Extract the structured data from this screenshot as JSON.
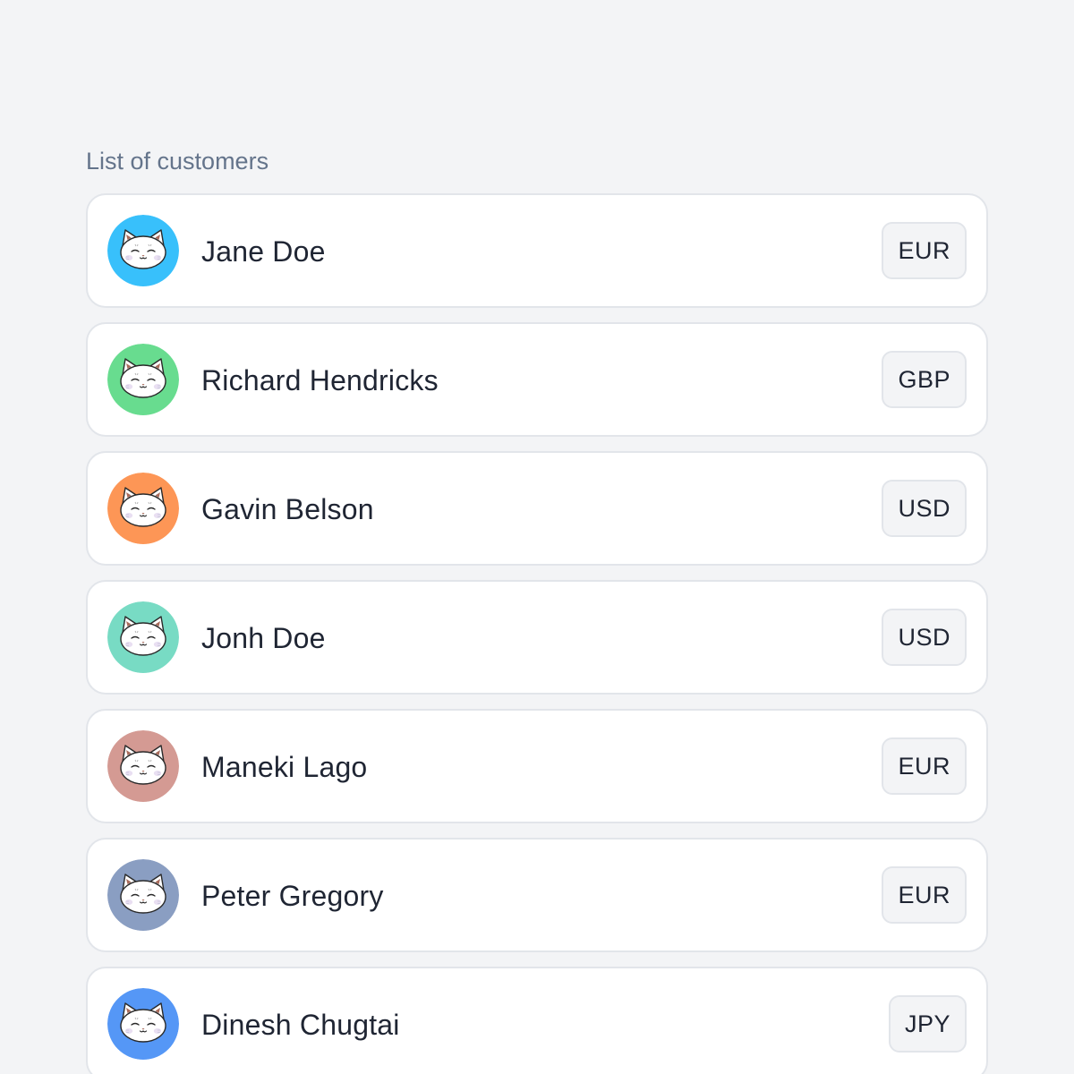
{
  "section_title": "List of customers",
  "customers": [
    {
      "name": "Jane Doe",
      "currency": "EUR",
      "avatar_color": "#38c0fb",
      "avatar_icon": "cat-face-icon"
    },
    {
      "name": "Richard Hendricks",
      "currency": "GBP",
      "avatar_color": "#68dc8f",
      "avatar_icon": "cat-face-icon"
    },
    {
      "name": "Gavin Belson",
      "currency": "USD",
      "avatar_color": "#fd9656",
      "avatar_icon": "cat-face-icon"
    },
    {
      "name": "Jonh Doe",
      "currency": "USD",
      "avatar_color": "#78dbc4",
      "avatar_icon": "cat-face-icon"
    },
    {
      "name": "Maneki Lago",
      "currency": "EUR",
      "avatar_color": "#d49a93",
      "avatar_icon": "cat-face-icon"
    },
    {
      "name": "Peter Gregory",
      "currency": "EUR",
      "avatar_color": "#8a9ec2",
      "avatar_icon": "cat-face-icon"
    },
    {
      "name": "Dinesh Chugtai",
      "currency": "JPY",
      "avatar_color": "#5597f6",
      "avatar_icon": "cat-face-icon"
    }
  ]
}
